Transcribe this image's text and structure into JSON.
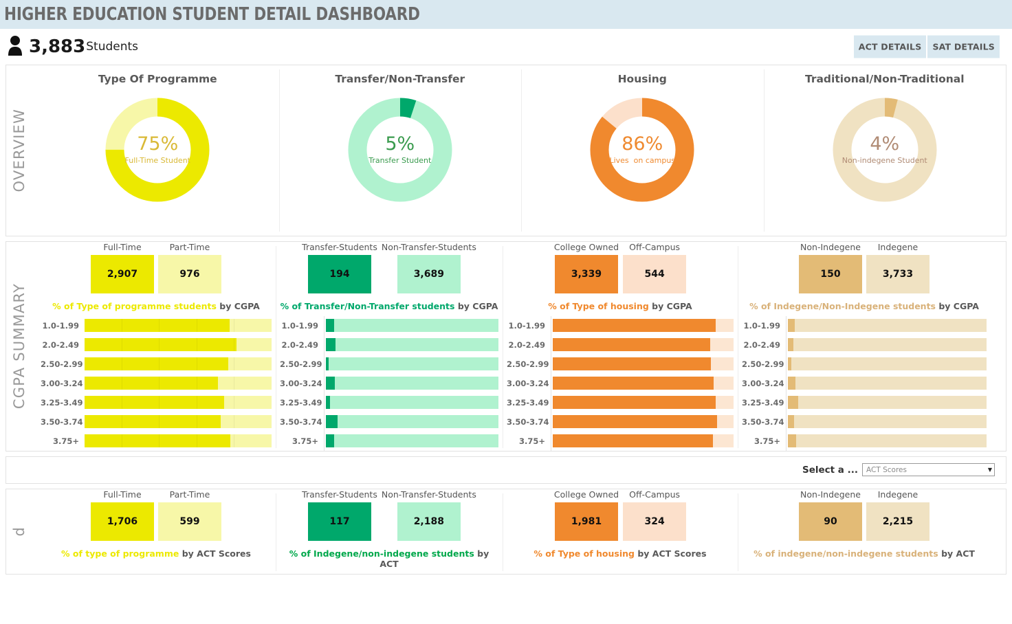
{
  "header": {
    "title": "HIGHER EDUCATION STUDENT DETAIL DASHBOARD",
    "student_count": "3,883",
    "student_label": "Students",
    "person_icon": "person-icon",
    "buttons": [
      {
        "label": "ACT DETAILS",
        "name": "act-details-button"
      },
      {
        "label": "SAT DETAILS",
        "name": "sat-details-button"
      }
    ]
  },
  "sections": {
    "overview_label": "OVERVIEW",
    "cgpa_label": "CGPA SUMMARY",
    "scores_label": "d"
  },
  "colors": {
    "header_bg": "#d9e8f0",
    "yellow": "#ece900",
    "yellow_light": "#f7f7a8",
    "yellow_text": "#d9b936",
    "green": "#00b377",
    "green_light": "#b0f2cf",
    "green_text": "#3a9b4e",
    "orange": "#f0892e",
    "orange_light": "#fce6d2",
    "orange_text": "#ef8a30",
    "tan": "#e7c98a",
    "tan_light": "#f0e2c2",
    "tan_text": "#b08b74"
  },
  "overview": [
    {
      "title": "Type Of Programme",
      "percent": 75,
      "percent_label": "75%",
      "caption": "Full-Time Student",
      "arc_color": "#ece900",
      "rest_color": "#f7f7a8",
      "text_color": "#d9b936"
    },
    {
      "title": "Transfer/Non-Transfer",
      "percent": 5,
      "percent_label": "5%",
      "caption": "Transfer Student",
      "arc_color": "#00a86b",
      "rest_color": "#b0f2cf",
      "text_color": "#3a9b4e"
    },
    {
      "title": "Housing",
      "percent": 86,
      "percent_label": "86%",
      "caption": "Lives  on campus",
      "arc_color": "#f0892e",
      "rest_color": "#fce0cb",
      "text_color": "#ef8a30"
    },
    {
      "title": "Traditional/Non-Traditional",
      "percent": 4,
      "percent_label": "4%",
      "caption": "Non-indegene Student",
      "arc_color": "#e3bb76",
      "rest_color": "#f0e2c2",
      "text_color": "#b08b74"
    }
  ],
  "cgpa_groups": [
    {
      "name": "programme",
      "kpis": [
        {
          "label": "Full-Time",
          "value": "2,907",
          "color": "#ece900"
        },
        {
          "label": "Part-Time",
          "value": "976",
          "color": "#f7f7a8"
        }
      ],
      "subtitle_colored": "% of Type of programme students",
      "subtitle_plain": " by CGPA",
      "subtitle_color": "#ece900",
      "axis_line": false,
      "show_grid": true,
      "bar_color": "#ece900",
      "rest_color": "#f7f7a8",
      "chart_data": {
        "type": "bar",
        "title": "% of Type of programme students by CGPA",
        "categories": [
          "1.0-1.99",
          "2.0-2.49",
          "2.50-2.99",
          "3.00-3.24",
          "3.25-3.49",
          "3.50-3.74",
          "3.75+"
        ],
        "series": [
          {
            "name": "Full-Time",
            "values": [
              77.5,
              81.4,
              76.7,
              71.3,
              74.8,
              72.9,
              77.9
            ]
          },
          {
            "name": "Part-Time",
            "values": [
              22.5,
              18.6,
              23.3,
              28.7,
              25.2,
              27.1,
              22.1
            ]
          }
        ],
        "xlabel": "",
        "ylabel": "CGPA",
        "xlim": [
          0,
          100
        ],
        "grid": true,
        "legend": "none",
        "stacked": true
      }
    },
    {
      "name": "transfer",
      "kpis": [
        {
          "label": "Transfer-Students",
          "value": "194",
          "color": "#00a86b"
        },
        {
          "label": "Non-Transfer-Students",
          "value": "3,689",
          "color": "#b0f2cf"
        }
      ],
      "subtitle_colored": "% of Transfer/Non-Transfer students",
      "subtitle_plain": " by CGPA",
      "subtitle_color": "#00a86b",
      "axis_line": true,
      "show_grid": false,
      "bar_color": "#00a86b",
      "rest_color": "#b0f2cf",
      "chart_data": {
        "type": "bar",
        "title": "% of Transfer/Non-Transfer students by CGPA",
        "categories": [
          "1.0-1.99",
          "2.0-2.49",
          "2.50-2.99",
          "3.00-3.24",
          "3.25-3.49",
          "3.50-3.74",
          "3.75+"
        ],
        "series": [
          {
            "name": "Transfer-Students",
            "values": [
              4.7,
              5.5,
              1.7,
              5.1,
              2.5,
              6.8,
              4.7
            ]
          },
          {
            "name": "Non-Transfer-Students",
            "values": [
              95.3,
              94.5,
              98.3,
              94.9,
              97.5,
              93.2,
              95.3
            ]
          }
        ],
        "xlabel": "",
        "ylabel": "CGPA",
        "xlim": [
          0,
          100
        ],
        "grid": false,
        "legend": "none",
        "stacked": true
      }
    },
    {
      "name": "housing",
      "kpis": [
        {
          "label": "College Owned",
          "value": "3,339",
          "color": "#f0892e"
        },
        {
          "label": "Off-Campus",
          "value": "544",
          "color": "#fce0cb"
        }
      ],
      "subtitle_colored": "% of Type of housing",
      "subtitle_plain": " by CGPA",
      "subtitle_color": "#f0892e",
      "axis_line": true,
      "show_grid": false,
      "bar_color": "#f0892e",
      "rest_color": "#fce6d2",
      "chart_data": {
        "type": "bar",
        "title": "% of Type of housing by CGPA",
        "categories": [
          "1.0-1.99",
          "2.0-2.49",
          "2.50-2.99",
          "3.00-3.24",
          "3.25-3.49",
          "3.50-3.74",
          "3.75+"
        ],
        "series": [
          {
            "name": "College Owned",
            "values": [
              90.3,
              86.9,
              87.3,
              89.0,
              90.3,
              90.7,
              88.6
            ]
          },
          {
            "name": "Off-Campus",
            "values": [
              9.7,
              13.1,
              12.7,
              11.0,
              9.7,
              9.3,
              11.4
            ]
          }
        ],
        "xlabel": "",
        "ylabel": "CGPA",
        "xlim": [
          0,
          100
        ],
        "grid": false,
        "legend": "none",
        "stacked": true
      }
    },
    {
      "name": "indegene",
      "kpis": [
        {
          "label": "Non-Indegene",
          "value": "150",
          "color": "#e3bb76"
        },
        {
          "label": "Indegene",
          "value": "3,733",
          "color": "#f0e2c2"
        }
      ],
      "subtitle_colored": "% of Indegene/Non-Indegene students",
      "subtitle_plain": " by CGPA",
      "subtitle_color": "#d9b27a",
      "axis_line": true,
      "show_grid": false,
      "bar_color": "#e3bb76",
      "rest_color": "#f0e2c2",
      "chart_data": {
        "type": "bar",
        "title": "% of Indegene/Non-Indegene students by CGPA",
        "categories": [
          "1.0-1.99",
          "2.0-2.49",
          "2.50-2.99",
          "3.00-3.24",
          "3.25-3.49",
          "3.50-3.74",
          "3.75+"
        ],
        "series": [
          {
            "name": "Non-Indegene",
            "values": [
              3.4,
              2.9,
              1.7,
              3.8,
              5.1,
              3.0,
              4.2
            ]
          },
          {
            "name": "Indegene",
            "values": [
              96.6,
              97.1,
              98.3,
              96.2,
              94.9,
              97.0,
              95.8
            ]
          }
        ],
        "xlabel": "",
        "ylabel": "CGPA",
        "xlim": [
          0,
          100
        ],
        "grid": false,
        "legend": "none",
        "stacked": true
      }
    }
  ],
  "selector": {
    "label": "Select a ...",
    "value": "ACT Scores",
    "caret_icon": "chevron-down-icon"
  },
  "scores_groups": [
    {
      "name": "programme",
      "kpis": [
        {
          "label": "Full-Time",
          "value": "1,706",
          "color": "#ece900"
        },
        {
          "label": "Part-Time",
          "value": "599",
          "color": "#f7f7a8"
        }
      ],
      "subtitle_colored": "% of type of programme",
      "subtitle_plain": " by ACT Scores",
      "subtitle_color": "#ece900"
    },
    {
      "name": "transfer",
      "kpis": [
        {
          "label": "Transfer-Students",
          "value": "117",
          "color": "#00a86b"
        },
        {
          "label": "Non-Transfer-Students",
          "value": "2,188",
          "color": "#b0f2cf"
        }
      ],
      "subtitle_colored": "% of Indegene/non-indegene students",
      "subtitle_plain": " by ACT",
      "subtitle_color": "#00a84b"
    },
    {
      "name": "housing",
      "kpis": [
        {
          "label": "College Owned",
          "value": "1,981",
          "color": "#f0892e"
        },
        {
          "label": "Off-Campus",
          "value": "324",
          "color": "#fce0cb"
        }
      ],
      "subtitle_colored": "% of Type of housing",
      "subtitle_plain": " by ACT Scores",
      "subtitle_color": "#f0892e"
    },
    {
      "name": "indegene",
      "kpis": [
        {
          "label": "Non-Indegene",
          "value": "90",
          "color": "#e3bb76"
        },
        {
          "label": "Indegene",
          "value": "2,215",
          "color": "#f0e2c2"
        }
      ],
      "subtitle_colored": "% of indegene/non-indegene students",
      "subtitle_plain": " by ACT",
      "subtitle_color": "#d9b27a"
    }
  ]
}
